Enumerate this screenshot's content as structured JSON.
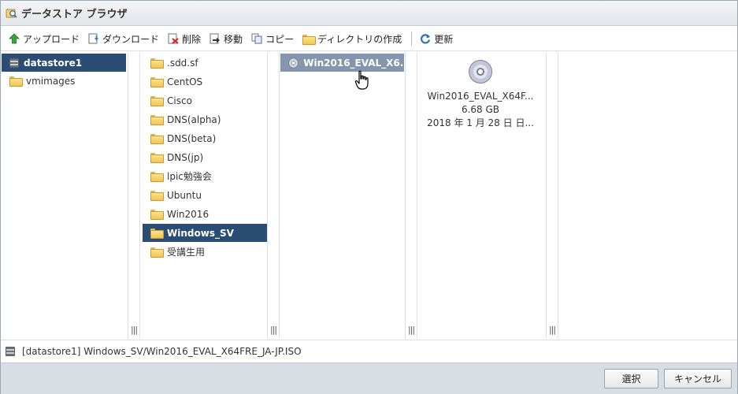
{
  "window": {
    "title": "データストア ブラウザ"
  },
  "toolbar": {
    "upload": "アップロード",
    "download": "ダウンロード",
    "delete": "削除",
    "move": "移動",
    "copy": "コピー",
    "mkdir": "ディレクトリの作成",
    "refresh": "更新"
  },
  "datastores": [
    {
      "label": "datastore1",
      "icon": "datastore-icon",
      "selected": true
    },
    {
      "label": "vmimages",
      "icon": "folder-icon",
      "selected": false
    }
  ],
  "folders": [
    {
      "label": ".sdd.sf"
    },
    {
      "label": "CentOS"
    },
    {
      "label": "Cisco"
    },
    {
      "label": "DNS(alpha)"
    },
    {
      "label": "DNS(beta)"
    },
    {
      "label": "DNS(jp)"
    },
    {
      "label": "lpic勉強会"
    },
    {
      "label": "Ubuntu"
    },
    {
      "label": "Win2016"
    },
    {
      "label": "Windows_SV"
    },
    {
      "label": "受講生用"
    }
  ],
  "files": [
    {
      "label": "Win2016_EVAL_X6...",
      "icon": "disc-icon"
    }
  ],
  "preview": {
    "name": "Win2016_EVAL_X64F...",
    "size": "6.68 GB",
    "date": "2018 年 1 月 28 日 日..."
  },
  "status": {
    "path": "[datastore1] Windows_SV/Win2016_EVAL_X64FRE_JA-JP.ISO"
  },
  "footer": {
    "select": "選択",
    "cancel": "キャンセル"
  },
  "colors": {
    "selection": "#2b4d74",
    "footer_bg": "#d8dde3"
  }
}
